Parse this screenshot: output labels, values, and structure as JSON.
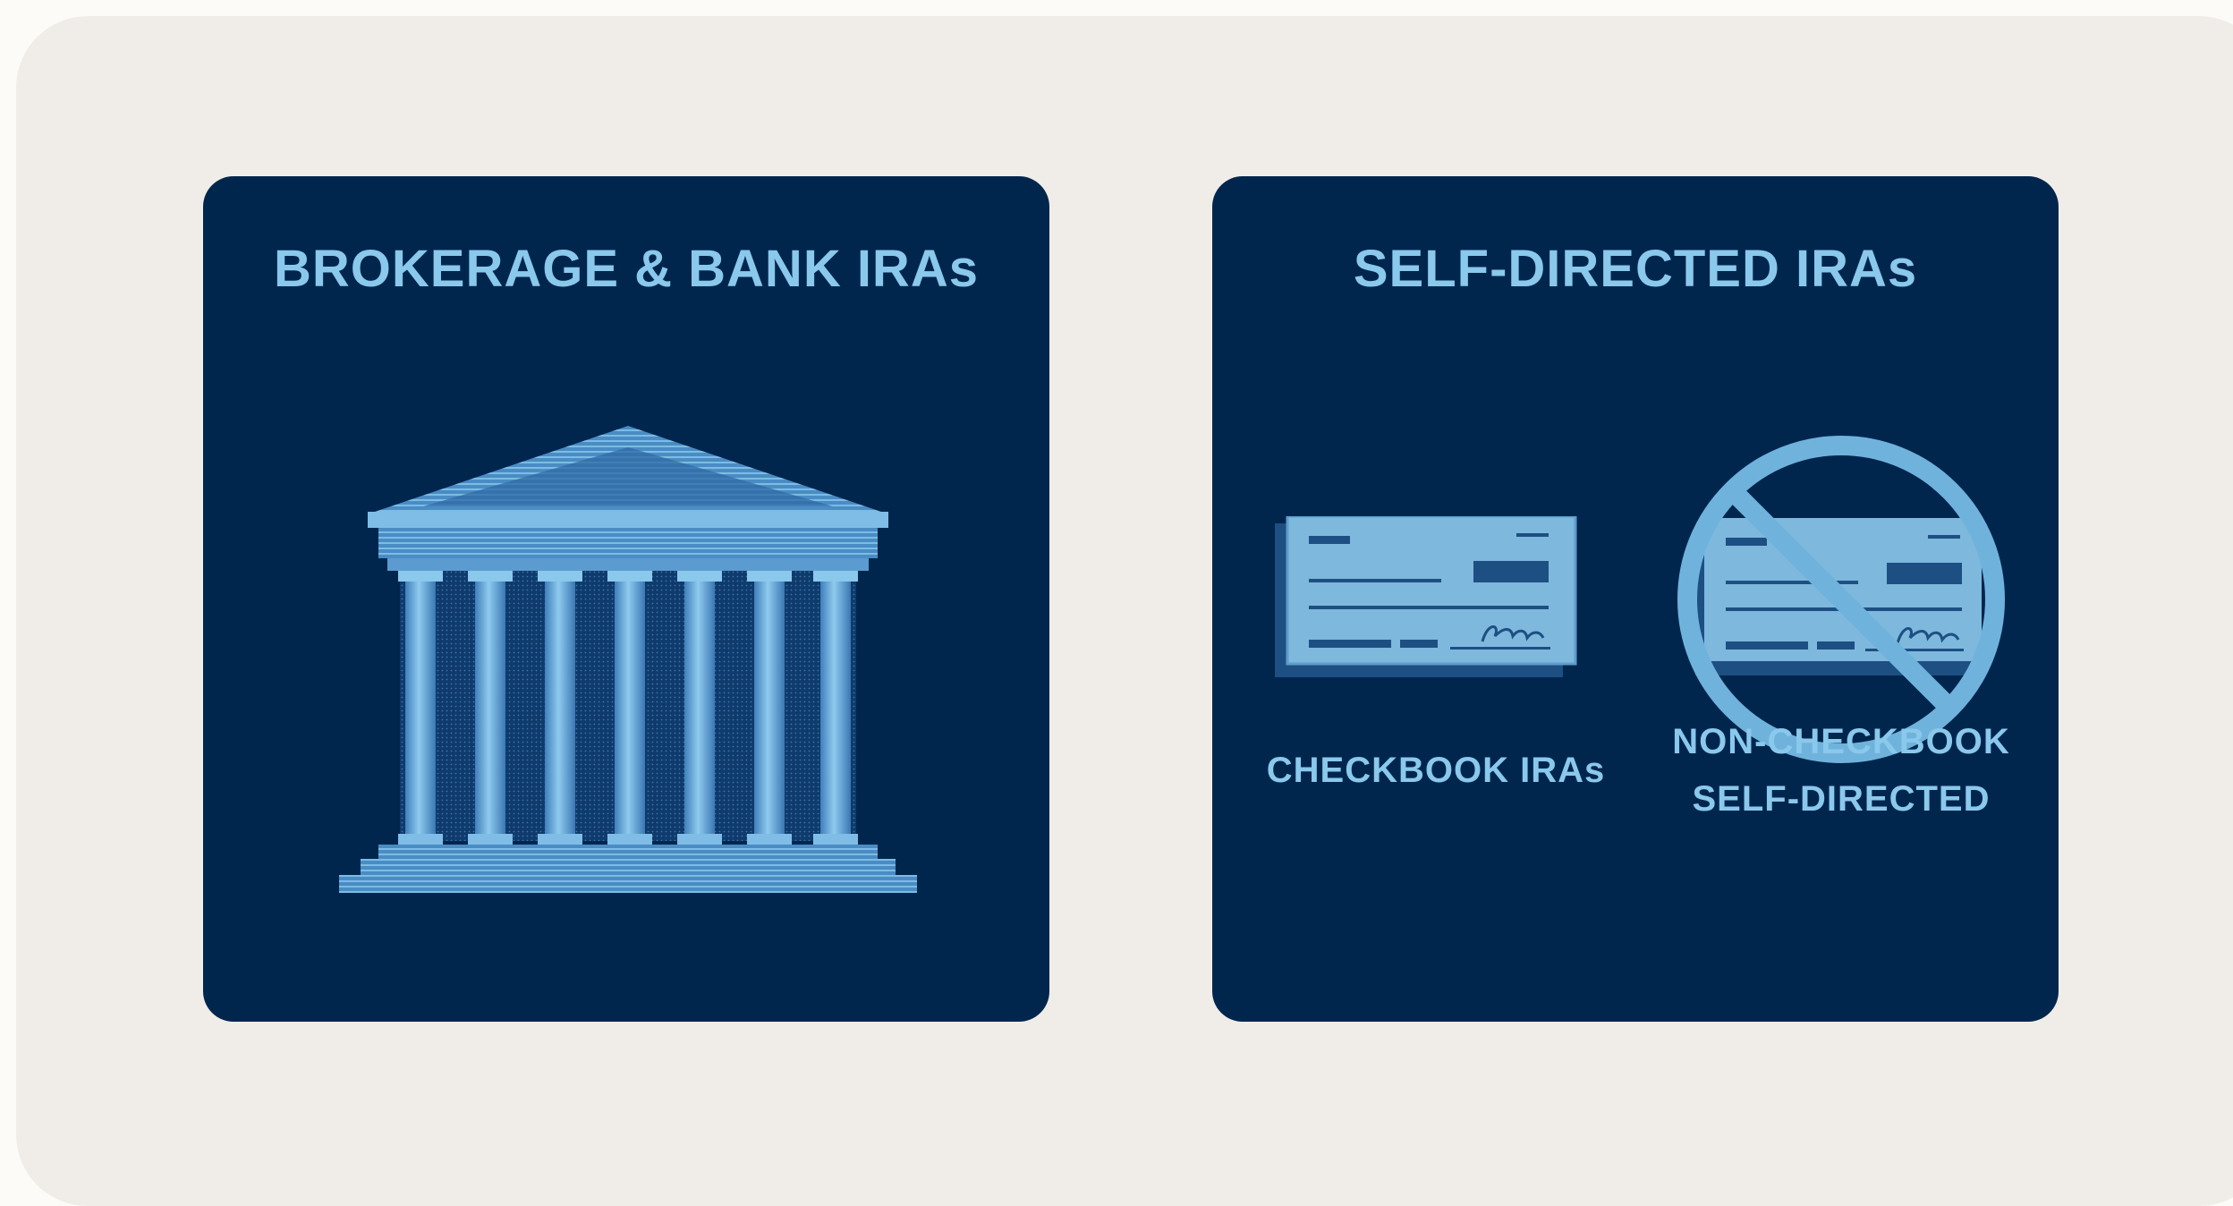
{
  "panels": {
    "left": {
      "title": "BROKERAGE & BANK IRAs",
      "icon": "bank-building-icon"
    },
    "right": {
      "title": "SELF-DIRECTED IRAs",
      "options": [
        {
          "label_lines": [
            "CHECKBOOK IRAs"
          ],
          "icon": "check-icon"
        },
        {
          "label_lines": [
            "NON-CHECKBOOK",
            "SELF-DIRECTED"
          ],
          "icon": "no-check-icon"
        }
      ]
    }
  },
  "colors": {
    "background": "#f0ede8",
    "panel": "#01264e",
    "accent": "#8ac8ec",
    "illustration": "#6fb3dc",
    "illustration_dark": "#2a5f94"
  }
}
